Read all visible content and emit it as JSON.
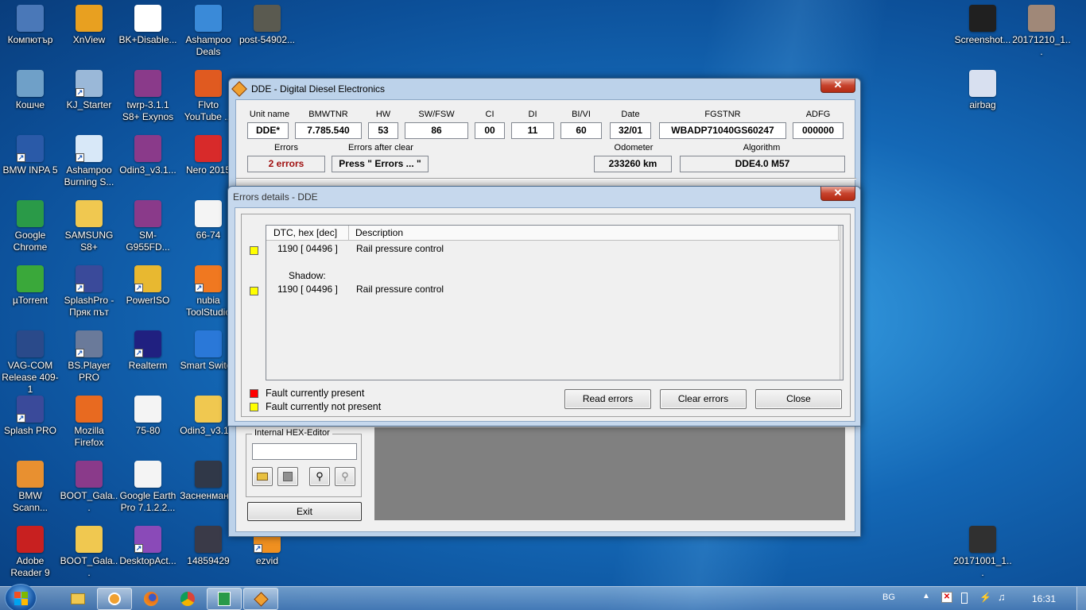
{
  "desktop": {
    "icons": [
      {
        "label": "Компютър",
        "icon": "computer-icon",
        "color": "#4a78b8"
      },
      {
        "label": "XnView",
        "icon": "xnview-icon",
        "color": "#e8a020"
      },
      {
        "label": "BK+Disable...",
        "icon": "document-icon",
        "color": "#ffffff"
      },
      {
        "label": "Ashampoo Deals",
        "icon": "ashampoo-deals-icon",
        "color": "#3a8ad8"
      },
      {
        "label": "post-54902...",
        "icon": "image-file-icon",
        "color": "#5a5a50"
      },
      {
        "label": "Кошче",
        "icon": "recycle-bin-icon",
        "color": "#6fa0c8"
      },
      {
        "label": "KJ_Starter",
        "icon": "shield-icon",
        "color": "#9ab8d8"
      },
      {
        "label": "twrp-3.1.1 S8+ Exynos",
        "icon": "winrar-archive-icon",
        "color": "#8a3a8a"
      },
      {
        "label": "Flvto YouTube ...",
        "icon": "flvto-icon",
        "color": "#e05a20"
      },
      {
        "label": "BMW INPA 5",
        "icon": "bmw-inpa-icon",
        "color": "#2a5aa8"
      },
      {
        "label": "Ashampoo Burning S...",
        "icon": "ashampoo-burning-icon",
        "color": "#d8e8f8"
      },
      {
        "label": "Odin3_v3.1...",
        "icon": "winrar-archive-icon",
        "color": "#8a3a8a"
      },
      {
        "label": "Nero 2015",
        "icon": "nero-icon",
        "color": "#d82a2a"
      },
      {
        "label": "Google Chrome",
        "icon": "chrome-icon",
        "color": "#2a9a48"
      },
      {
        "label": "SAMSUNG S8+",
        "icon": "folder-icon",
        "color": "#f0c850"
      },
      {
        "label": "SM-G955FD...",
        "icon": "winrar-archive-icon",
        "color": "#8a3a8a"
      },
      {
        "label": "66-74",
        "icon": "torrent-file-icon",
        "color": "#f4f4f4"
      },
      {
        "label": "µTorrent",
        "icon": "utorrent-icon",
        "color": "#3aa83a"
      },
      {
        "label": "SplashPro - Пряк път",
        "icon": "splash-pro-icon",
        "color": "#3a4a9a"
      },
      {
        "label": "PowerISO",
        "icon": "poweriso-icon",
        "color": "#e8b830"
      },
      {
        "label": "nubia ToolStudio",
        "icon": "nubia-icon",
        "color": "#f07820"
      },
      {
        "label": "VAG-COM Release 409-1",
        "icon": "vag-com-icon",
        "color": "#2a4a8a"
      },
      {
        "label": "BS.Player PRO",
        "icon": "bsplayer-icon",
        "color": "#6a7a9a"
      },
      {
        "label": "Realterm",
        "icon": "realterm-icon",
        "color": "#202080"
      },
      {
        "label": "Smart Switch",
        "icon": "smart-switch-icon",
        "color": "#2a78d8"
      },
      {
        "label": "Splash PRO",
        "icon": "splash-pro-icon",
        "color": "#3a4a9a"
      },
      {
        "label": "Mozilla Firefox",
        "icon": "firefox-icon",
        "color": "#e86a20"
      },
      {
        "label": "75-80",
        "icon": "torrent-file-icon",
        "color": "#f4f4f4"
      },
      {
        "label": "Odin3_v3.1...",
        "icon": "folder-icon",
        "color": "#f0c850"
      },
      {
        "label": "BMW Scann...",
        "icon": "bmw-scanner-icon",
        "color": "#e89030"
      },
      {
        "label": "BOOT_Gala...",
        "icon": "winrar-archive-icon",
        "color": "#8a3a8a"
      },
      {
        "label": "Google Earth Pro 7.1.2.2...",
        "icon": "torrent-file-icon",
        "color": "#f4f4f4"
      },
      {
        "label": "Засненман...",
        "icon": "image-file-icon",
        "color": "#303848"
      },
      {
        "label": "Adobe Reader 9",
        "icon": "adobe-reader-icon",
        "color": "#c82020"
      },
      {
        "label": "BOOT_Gala...",
        "icon": "folder-icon",
        "color": "#f0c850"
      },
      {
        "label": "DesktopAct...",
        "icon": "desktop-act-icon",
        "color": "#8a4ab8"
      },
      {
        "label": "14859429",
        "icon": "image-file-icon",
        "color": "#3a3a48"
      },
      {
        "label": "ezvid",
        "icon": "ezvid-icon",
        "color": "#f09020"
      },
      {
        "label": "Screenshot...",
        "icon": "phone-screenshot-icon",
        "color": "#202020"
      },
      {
        "label": "20171210_1...",
        "icon": "image-file-icon",
        "color": "#a08878"
      },
      {
        "label": "airbag",
        "icon": "image-file-icon",
        "color": "#d8e0f0"
      },
      {
        "label": "20171001_1...",
        "icon": "video-file-icon",
        "color": "#303030"
      }
    ]
  },
  "dde_window": {
    "title": "DDE - Digital Diesel Electronics",
    "close_glyph": "✕",
    "headers": {
      "unit_name": "Unit name",
      "bmwtnr": "BMWTNR",
      "hw": "HW",
      "sw_fsw": "SW/FSW",
      "ci": "CI",
      "di": "DI",
      "bi_vi": "BI/VI",
      "date": "Date",
      "fgstnr": "FGSTNR",
      "adfg": "ADFG",
      "errors": "Errors",
      "errors_after_clear": "Errors after clear",
      "odometer": "Odometer",
      "algorithm": "Algorithm"
    },
    "values": {
      "unit_name": "DDE*",
      "bmwtnr": "7.785.540",
      "hw": "53",
      "sw_fsw": "86",
      "ci": "00",
      "di": "11",
      "bi_vi": "60",
      "date": "32/01",
      "fgstnr": "WBADP71040GS60247",
      "adfg": "000000",
      "errors": "2 errors",
      "errors_after_clear": "Press \" Errors ... \"",
      "odometer": "233260 km",
      "algorithm": "DDE4.0 M57"
    },
    "hex_editor_label": "Internal HEX-Editor",
    "exit_label": "Exit"
  },
  "errors_window": {
    "title": "Errors details - DDE",
    "close_glyph": "✕",
    "columns": [
      "DTC, hex [dec]",
      "Description"
    ],
    "rows": [
      {
        "dtc": "1190 [ 04496 ]",
        "description": "Rail pressure control",
        "status": "not-present"
      },
      {
        "shadow_label": "Shadow:",
        "dtc": "1190 [ 04496 ]",
        "description": "Rail pressure control",
        "status": "not-present"
      }
    ],
    "legend": {
      "present": "Fault currently present",
      "not_present": "Fault currently not present"
    },
    "buttons": {
      "read": "Read errors",
      "clear": "Clear errors",
      "close": "Close"
    },
    "colors": {
      "present": "#ff0000",
      "not_present": "#ffff00"
    }
  },
  "taskbar": {
    "language": "BG",
    "time": "16:31"
  }
}
